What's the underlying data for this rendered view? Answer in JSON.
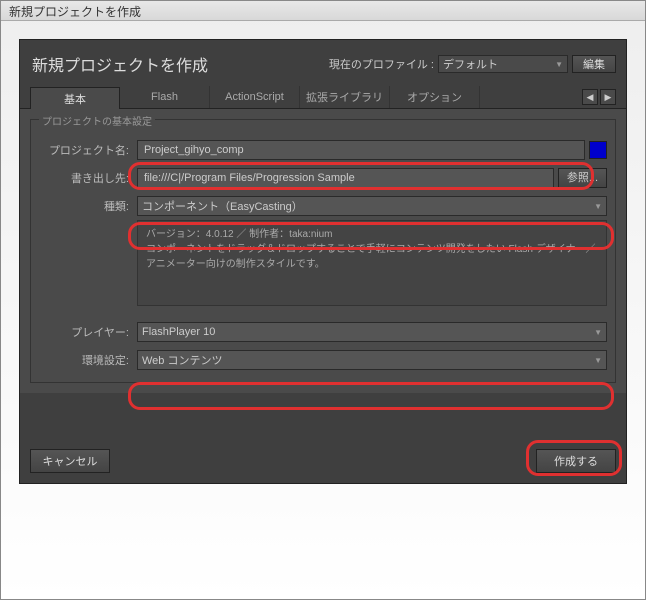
{
  "window": {
    "title": "新規プロジェクトを作成"
  },
  "header": {
    "title": "新規プロジェクトを作成",
    "profile_label": "現在のプロファイル :",
    "profile_value": "デフォルト",
    "edit_button": "編集"
  },
  "tabs": {
    "items": [
      "基本",
      "Flash",
      "ActionScript",
      "拡張ライブラリ",
      "オプション"
    ]
  },
  "fieldset": {
    "label": "プロジェクトの基本設定"
  },
  "fields": {
    "project_name": {
      "label": "プロジェクト名:",
      "value": "Project_gihyo_comp"
    },
    "output": {
      "label": "書き出し先:",
      "value": "file:///C|/Program Files/Progression Sample",
      "browse": "参照..."
    },
    "type": {
      "label": "種類:",
      "value": "コンポーネント（EasyCasting）"
    },
    "description": {
      "line1": "バージョン：4.0.12 ／ 制作者：taka:nium",
      "line2": "コンポーネントをドラッグ＆ドロップすることで手軽にコンテンツ開発をしたい Flash デザイナー／アニメーター向けの制作スタイルです。"
    },
    "player": {
      "label": "プレイヤー:",
      "value": "FlashPlayer 10"
    },
    "env": {
      "label": "環境設定:",
      "value": "Web コンテンツ"
    }
  },
  "footer": {
    "cancel": "キャンセル",
    "create": "作成する"
  }
}
